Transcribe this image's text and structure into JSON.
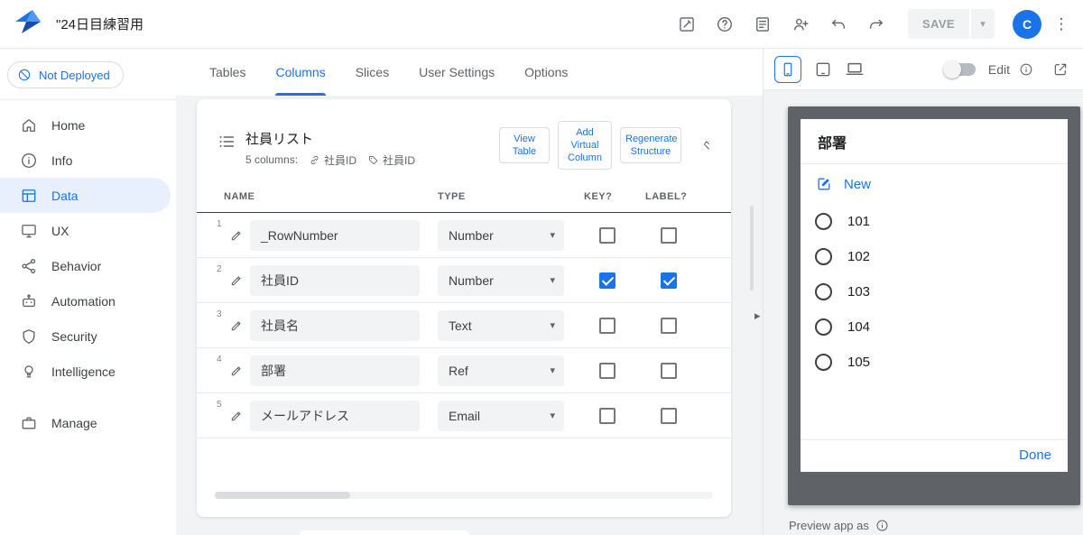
{
  "topbar": {
    "title": "\"24日目練習用",
    "save_label": "SAVE",
    "avatar_initial": "C"
  },
  "icons": {
    "kebab": "⋮",
    "select_arrow": "▾",
    "save_arrow": "▾",
    "collapse_handle": "▸"
  },
  "sidebar": {
    "deploy_status": "Not Deployed",
    "items": [
      {
        "label": "Home"
      },
      {
        "label": "Info"
      },
      {
        "label": "Data"
      },
      {
        "label": "UX"
      },
      {
        "label": "Behavior"
      },
      {
        "label": "Automation"
      },
      {
        "label": "Security"
      },
      {
        "label": "Intelligence"
      },
      {
        "label": "Manage"
      }
    ]
  },
  "main": {
    "tabs": [
      {
        "label": "Tables"
      },
      {
        "label": "Columns"
      },
      {
        "label": "Slices"
      },
      {
        "label": "User Settings"
      },
      {
        "label": "Options"
      }
    ],
    "table_card": {
      "title": "社員リスト",
      "columns_summary": "5 columns:",
      "key_column": "社員ID",
      "label_column": "社員ID",
      "view_table_label": "View Table",
      "add_virtual_label": "Add Virtual Column",
      "regenerate_label": "Regenerate Structure",
      "headers": {
        "name": "NAME",
        "type": "TYPE",
        "key": "KEY?",
        "label": "LABEL?"
      },
      "rows": [
        {
          "num": "1",
          "name": "_RowNumber",
          "type": "Number",
          "key": false,
          "label": false
        },
        {
          "num": "2",
          "name": "社員ID",
          "type": "Number",
          "key": true,
          "label": true
        },
        {
          "num": "3",
          "name": "社員名",
          "type": "Text",
          "key": false,
          "label": false
        },
        {
          "num": "4",
          "name": "部署",
          "type": "Ref",
          "key": false,
          "label": false
        },
        {
          "num": "5",
          "name": "メールアドレス",
          "type": "Email",
          "key": false,
          "label": false
        }
      ]
    }
  },
  "preview": {
    "edit_label": "Edit",
    "app": {
      "title": "部署",
      "new_label": "New",
      "options": [
        "101",
        "102",
        "103",
        "104",
        "105"
      ],
      "done_label": "Done"
    },
    "footer_label": "Preview app as"
  },
  "colors": {
    "accent": "#1a73e8",
    "phone_frame": "#5f6368"
  }
}
